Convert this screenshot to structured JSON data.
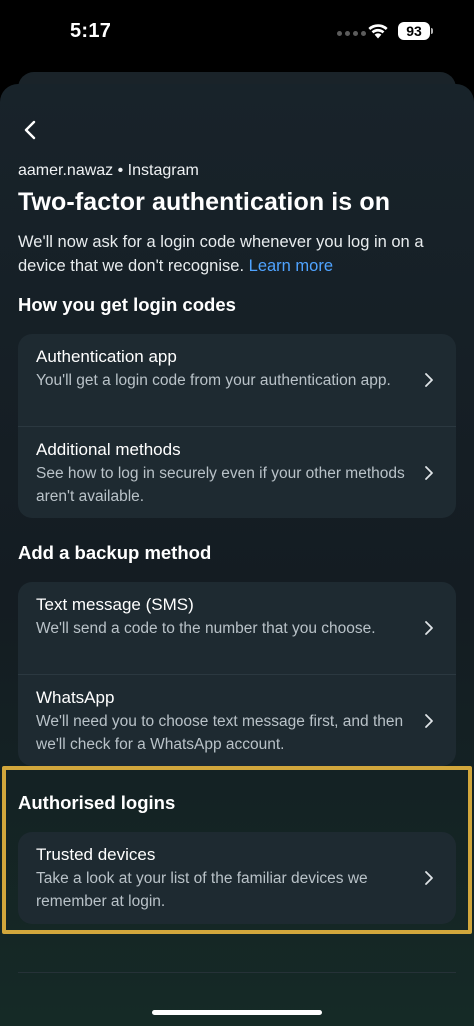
{
  "status": {
    "time": "5:17",
    "battery": "93"
  },
  "header": {
    "account": "aamer.nawaz • Instagram",
    "title": "Two-factor authentication is on",
    "description": "We'll now ask for a login code whenever you log in on a device that we don't recognise.",
    "learn_more": "Learn more"
  },
  "sections": {
    "login_codes": {
      "heading": "How you get login codes",
      "items": [
        {
          "title": "Authentication app",
          "subtitle": "You'll get a login code from your authentication app."
        },
        {
          "title": "Additional methods",
          "subtitle": "See how to log in securely even if your other methods aren't available."
        }
      ]
    },
    "backup": {
      "heading": "Add a backup method",
      "items": [
        {
          "title": "Text message (SMS)",
          "subtitle": "We'll send a code to the number that you choose."
        },
        {
          "title": "WhatsApp",
          "subtitle": "We'll need you to choose text message first, and then we'll check for a WhatsApp account."
        }
      ]
    },
    "authorised": {
      "heading": "Authorised logins",
      "items": [
        {
          "title": "Trusted devices",
          "subtitle": "Take a look at your list of the familiar devices we remember at login."
        }
      ]
    }
  },
  "colors": {
    "accent_link": "#4fa3ff",
    "highlight": "#d2a73c",
    "card": "#1e2a31"
  }
}
